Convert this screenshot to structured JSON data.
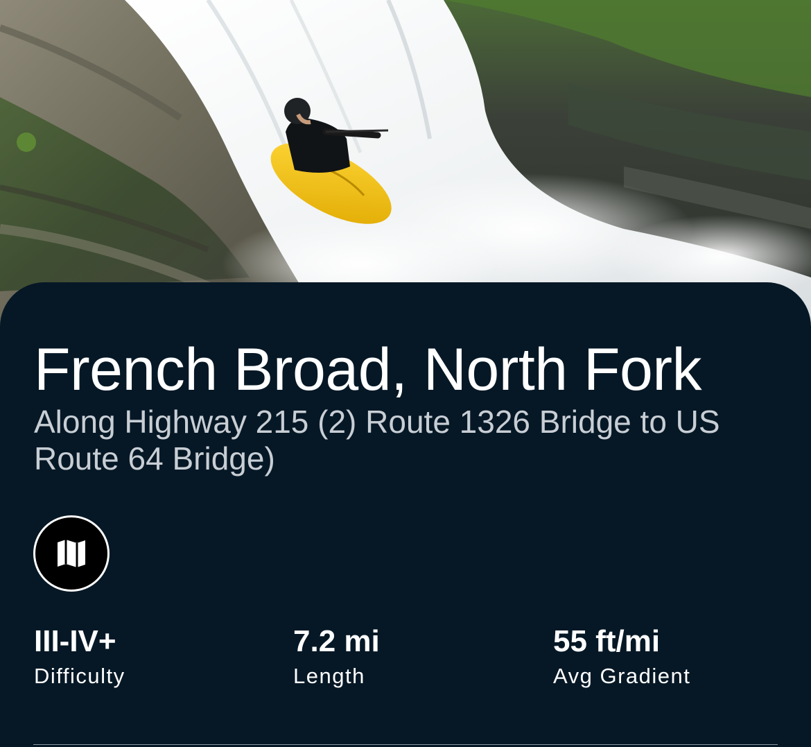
{
  "river": {
    "name": "French Broad, North Fork",
    "section": "Along Highway 215 (2) Route 1326 Bridge to US Route 64 Bridge)"
  },
  "hero": {
    "scene": "kayaker-descending-waterfall-photo"
  },
  "actions": {
    "map_icon": "map-icon"
  },
  "stats": [
    {
      "value": "III-IV+",
      "label": "Difficulty"
    },
    {
      "value": "7.2 mi",
      "label": "Length"
    },
    {
      "value": "55 ft/mi",
      "label": "Avg Gradient"
    }
  ],
  "colors": {
    "sheet_background": "#061826",
    "kayak": "#f4c21c",
    "text_primary": "#ffffff",
    "text_secondary": "#c8ced4"
  }
}
